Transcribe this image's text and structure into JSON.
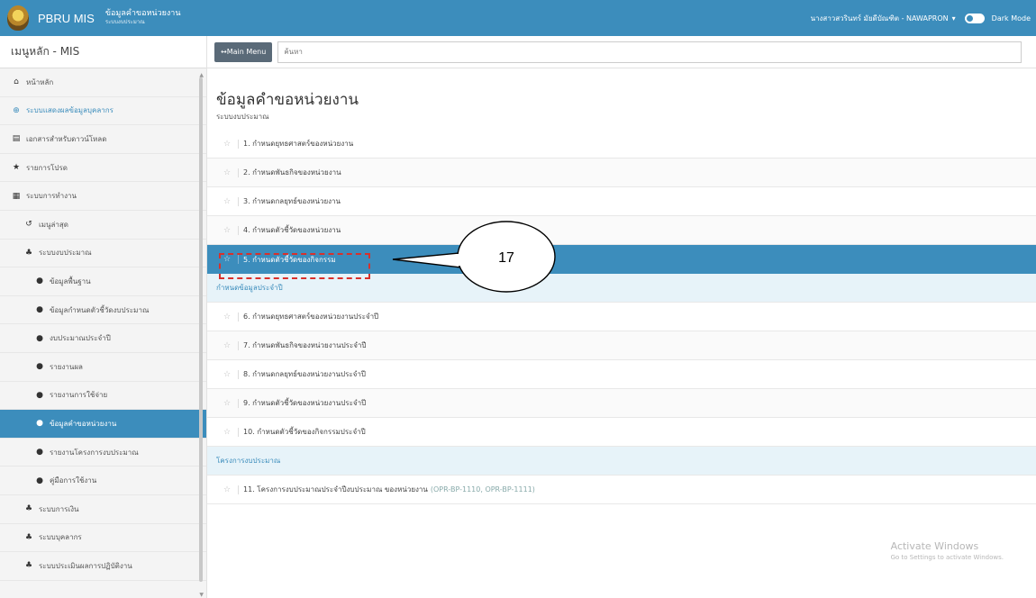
{
  "topbar": {
    "brand": "PBRU MIS",
    "subtitle": "ข้อมูลคำขอหน่วยงาน",
    "subtitle_small": "ระบบงบประมาณ",
    "user": "นางสาวสวรินทร์ มัยดีบัณฑิต - NAWAPRON",
    "dark_mode_label": "Dark Mode"
  },
  "sidebar": {
    "header": "เมนูหลัก - MIS",
    "items": [
      {
        "label": "หน้าหลัก",
        "icon": "home-icon"
      },
      {
        "label": "ระบบแสดงผลข้อมูลบุคลากร",
        "icon": "globe-icon"
      },
      {
        "label": "เอกสารสำหรับดาวน์โหลด",
        "icon": "document-icon"
      },
      {
        "label": "รายการโปรด",
        "icon": "star-icon"
      },
      {
        "label": "ระบบการทำงาน",
        "icon": "grid-icon"
      },
      {
        "label": "เมนูล่าสุด",
        "icon": "history-icon"
      },
      {
        "label": "ระบบงบประมาณ",
        "icon": "users-icon"
      },
      {
        "label": "ข้อมูลพื้นฐาน",
        "icon": "circle-icon"
      },
      {
        "label": "ข้อมูลกำหนดตัวชี้วัดงบประมาณ",
        "icon": "circle-icon"
      },
      {
        "label": "งบประมาณประจำปี",
        "icon": "circle-icon"
      },
      {
        "label": "รายงานผล",
        "icon": "circle-icon"
      },
      {
        "label": "รายงานการใช้จ่าย",
        "icon": "circle-icon"
      },
      {
        "label": "ข้อมูลคำขอหน่วยงาน",
        "icon": "circle-icon"
      },
      {
        "label": "รายงานโครงการงบประมาณ",
        "icon": "circle-icon"
      },
      {
        "label": "คู่มือการใช้งาน",
        "icon": "circle-icon"
      },
      {
        "label": "ระบบการเงิน",
        "icon": "users-icon"
      },
      {
        "label": "ระบบบุคลากร",
        "icon": "users-icon"
      },
      {
        "label": "ระบบประเมินผลการปฏิบัติงาน",
        "icon": "users-icon"
      }
    ]
  },
  "toolbar": {
    "main_menu_label": "↔Main Menu",
    "search_placeholder": "ค้นหา"
  },
  "main": {
    "title": "ข้อมูลคำขอหน่วยงาน",
    "subtitle": "ระบบงบประมาณ",
    "rows": [
      {
        "label": "1. กำหนดยุทธศาสตร์ของหน่วยงาน"
      },
      {
        "label": "2. กำหนดพันธกิจของหน่วยงาน"
      },
      {
        "label": "3. กำหนดกลยุทธ์ของหน่วยงาน"
      },
      {
        "label": "4. กำหนดตัวชี้วัดของหน่วยงาน"
      },
      {
        "label": "5. กำหนดตัวชี้วัดของกิจกรรม"
      },
      {
        "section": "กำหนดข้อมูลประจำปี"
      },
      {
        "label": "6. กำหนดยุทธศาสตร์ของหน่วยงานประจำปี"
      },
      {
        "label": "7. กำหนดพันธกิจของหน่วยงานประจำปี"
      },
      {
        "label": "8. กำหนดกลยุทธ์ของหน่วยงานประจำปี"
      },
      {
        "label": "9. กำหนดตัวชี้วัดของหน่วยงานประจำปี"
      },
      {
        "label": "10. กำหนดตัวชี้วัดของกิจกรรมประจำปี"
      },
      {
        "section": "โครงการงบประมาณ"
      },
      {
        "label": "11. โครงการงบประมาณประจำปีงบประมาณ ของหน่วยงาน",
        "code": "(OPR-BP-1110, OPR-BP-1111)"
      }
    ]
  },
  "annotation": {
    "number": "17"
  },
  "watermark": {
    "line1": "Activate Windows",
    "line2": "Go to Settings to activate Windows."
  },
  "colors": {
    "primary": "#3c8dbc",
    "annotation_red": "#d9302b"
  }
}
